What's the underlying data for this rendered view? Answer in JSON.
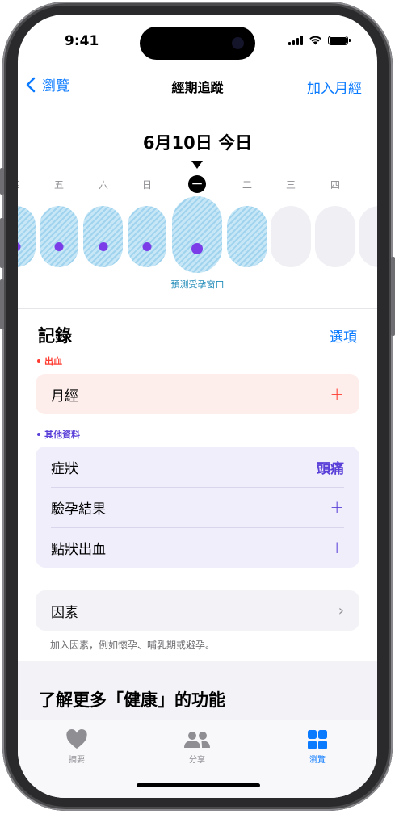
{
  "status": {
    "time": "9:41"
  },
  "nav": {
    "back_label": "瀏覽",
    "title": "經期追蹤",
    "add_label": "加入月經"
  },
  "date_header": "6月10日 今日",
  "calendar": {
    "weekdays": [
      "四",
      "五",
      "六",
      "日",
      "一",
      "二",
      "三",
      "四"
    ],
    "today_weekday": "一",
    "days": [
      {
        "state": "fertile",
        "logged": true
      },
      {
        "state": "fertile",
        "logged": true
      },
      {
        "state": "fertile",
        "logged": true
      },
      {
        "state": "fertile",
        "logged": true
      },
      {
        "state": "fertile",
        "logged": true,
        "today": true
      },
      {
        "state": "fertile",
        "logged": false
      },
      {
        "state": "empty",
        "logged": false
      },
      {
        "state": "empty",
        "logged": false
      },
      {
        "state": "empty",
        "logged": false
      }
    ],
    "fertile_window_label": "預測受孕窗口"
  },
  "log": {
    "title": "記錄",
    "options_label": "選項",
    "bleeding": {
      "category_label": "出血",
      "items": [
        {
          "label": "月經",
          "action": "+"
        }
      ]
    },
    "other": {
      "category_label": "其他資料",
      "items": [
        {
          "label": "症狀",
          "value": "頭痛"
        },
        {
          "label": "驗孕結果",
          "action": "+"
        },
        {
          "label": "點狀出血",
          "action": "+"
        }
      ]
    },
    "factors": {
      "label": "因素",
      "hint": "加入因素，例如懷孕、哺乳期或避孕。"
    }
  },
  "learn_more": {
    "title": "了解更多「健康」的功能"
  },
  "tabs": [
    {
      "label": "摘要",
      "icon": "heart-icon",
      "active": false
    },
    {
      "label": "分享",
      "icon": "people-icon",
      "active": false
    },
    {
      "label": "瀏覽",
      "icon": "grid-icon",
      "active": true
    }
  ],
  "colors": {
    "accent": "#0a7aff",
    "bleeding": "#ff3b30",
    "bleeding_bg": "#fdeeec",
    "other": "#5a3fd8",
    "other_bg": "#f0eefb",
    "fertile": "#9fd3ee",
    "logged_dot": "#7a3de8",
    "inactive_tab": "#8e8e93"
  }
}
